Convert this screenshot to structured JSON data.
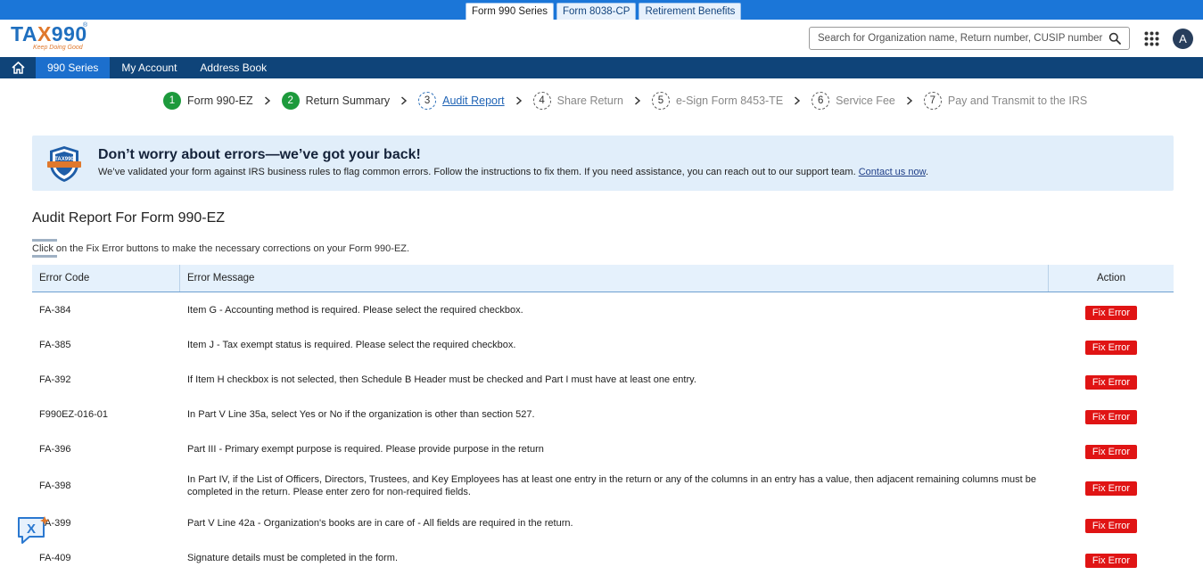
{
  "product_tabs": [
    {
      "label": "Form 990 Series",
      "active": true
    },
    {
      "label": "Form 8038-CP",
      "active": false
    },
    {
      "label": "Retirement Benefits",
      "active": false
    }
  ],
  "header": {
    "logo_text": "TAX990",
    "logo_tagline": "Keep Doing Good",
    "search_placeholder": "Search for Organization name, Return number, CUSIP number",
    "avatar_initial": "A"
  },
  "nav": {
    "items": [
      {
        "label": "990 Series",
        "active": true
      },
      {
        "label": "My Account",
        "active": false
      },
      {
        "label": "Address Book",
        "active": false
      }
    ]
  },
  "stepper": {
    "steps": [
      {
        "num": "1",
        "label": "Form 990-EZ",
        "state": "done"
      },
      {
        "num": "2",
        "label": "Return Summary",
        "state": "done"
      },
      {
        "num": "3",
        "label": "Audit Report",
        "state": "current"
      },
      {
        "num": "4",
        "label": "Share Return",
        "state": "todo"
      },
      {
        "num": "5",
        "label": "e-Sign Form 8453-TE",
        "state": "todo"
      },
      {
        "num": "6",
        "label": "Service Fee",
        "state": "todo"
      },
      {
        "num": "7",
        "label": "Pay and Transmit to the IRS",
        "state": "todo"
      }
    ]
  },
  "banner": {
    "badge_text": "TAX990",
    "title": "Don’t worry about errors—we’ve got your back!",
    "text": "We’ve validated your form against IRS business rules to flag common errors. Follow the instructions to fix them. If you need assistance, you can reach out to our support team.",
    "link": "Contact us now",
    "link_suffix": "."
  },
  "page": {
    "title": "Audit Report For Form 990-EZ",
    "instructions": "Click on the Fix Error buttons to make the necessary corrections on your Form 990-EZ."
  },
  "table": {
    "headers": {
      "code": "Error Code",
      "message": "Error Message",
      "action": "Action"
    },
    "button_label": "Fix Error",
    "rows": [
      {
        "code": "FA-384",
        "message": "Item G - Accounting method is required. Please select the required checkbox."
      },
      {
        "code": "FA-385",
        "message": "Item J - Tax exempt status is required. Please select the required checkbox."
      },
      {
        "code": "FA-392",
        "message": "If Item H checkbox is not selected, then Schedule B Header must be checked and Part I must have at least one entry."
      },
      {
        "code": "F990EZ-016-01",
        "message": "In Part V Line 35a, select Yes or No if the organization is other than section 527."
      },
      {
        "code": "FA-396",
        "message": "Part III - Primary exempt purpose is required. Please provide purpose in the return"
      },
      {
        "code": "FA-398",
        "message": "In Part IV, if the List of Officers, Directors, Trustees, and Key Employees has at least one entry in the return or any of the columns in an entry has a value, then adjacent remaining columns must be completed in the return. Please enter zero for non-required fields."
      },
      {
        "code": "FA-399",
        "message": "Part V Line 42a - Organization's books are in care of - All fields are required in the return."
      },
      {
        "code": "FA-409",
        "message": "Signature details must be completed in the form."
      }
    ]
  },
  "colors": {
    "brand_blue": "#1b76d8",
    "nav_bg": "#0f4479",
    "nav_active": "#1c6fcd",
    "step_done": "#1d9a3c",
    "fix_button": "#e01414",
    "banner_bg": "#e1eefa"
  }
}
